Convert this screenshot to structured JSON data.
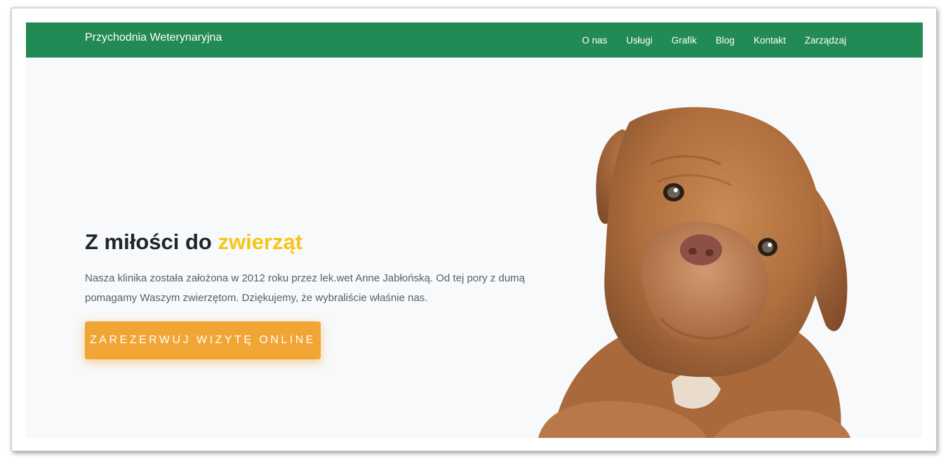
{
  "navbar": {
    "brand": "Przychodnia Weterynaryjna",
    "links": [
      "O nas",
      "Usługi",
      "Grafik",
      "Blog",
      "Kontakt",
      "Zarządzaj"
    ]
  },
  "hero": {
    "title_main": "Z miłości do ",
    "title_accent": "zwierząt",
    "description": "Nasza klinika została założona w 2012 roku przez lek.wet Anne Jabłońską. Od tej pory z dumą pomagamy Waszym zwierzętom. Dziękujemy, że wybraliście właśnie nas.",
    "cta_label": "ZAREZERWUJ WIZYTĘ ONLINE"
  },
  "colors": {
    "navbar": "#218a55",
    "accent": "#f5c518",
    "cta": "#f0a535",
    "page_background": "#f8f9fa"
  },
  "icons": {
    "hero_image": "puppy-image"
  }
}
